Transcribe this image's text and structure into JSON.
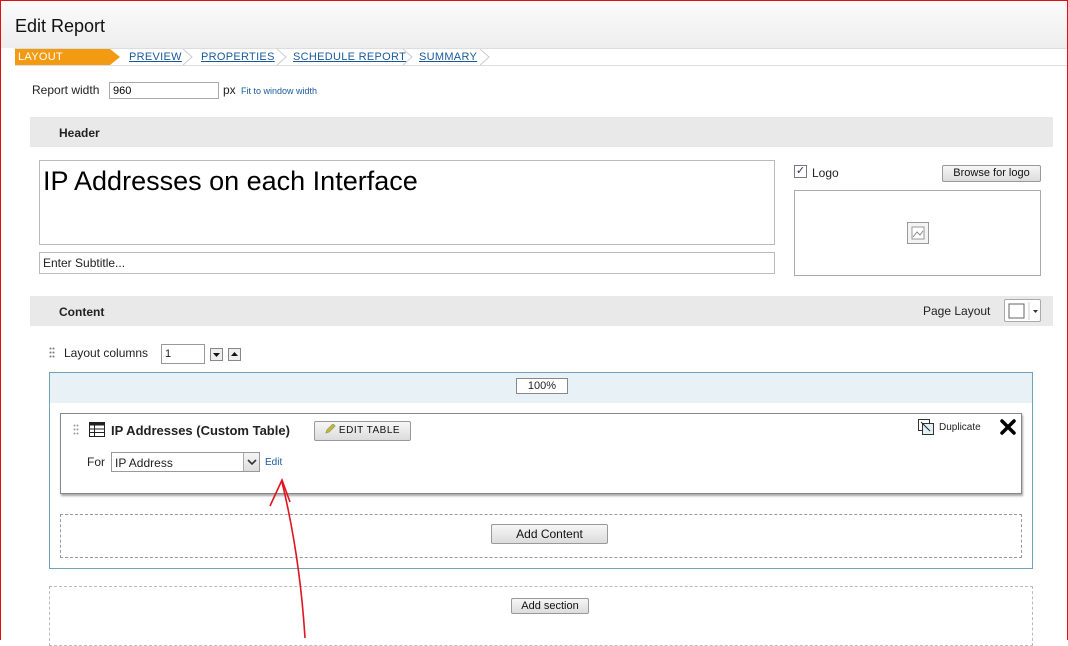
{
  "page": {
    "title": "Edit Report"
  },
  "steps": [
    {
      "label": "LAYOUT BUILDER",
      "active": true
    },
    {
      "label": "PREVIEW",
      "active": false
    },
    {
      "label": "PROPERTIES",
      "active": false
    },
    {
      "label": "SCHEDULE REPORT",
      "active": false
    },
    {
      "label": "SUMMARY",
      "active": false
    }
  ],
  "report_width": {
    "label": "Report width",
    "value": "960",
    "unit": "px",
    "fit_link": "Fit to window width"
  },
  "header": {
    "title": "Header",
    "report_title": "IP Addresses on each Interface",
    "subtitle": "Enter Subtitle...",
    "logo_label": "Logo",
    "logo_checked": true,
    "browse_button": "Browse for logo"
  },
  "content": {
    "title": "Content",
    "page_layout_label": "Page Layout",
    "layout_columns_label": "Layout columns",
    "layout_columns_value": "1",
    "column_width": "100%",
    "widget": {
      "title": "IP Addresses (Custom Table)",
      "edit_table_button": "EDIT TABLE",
      "duplicate_label": "Duplicate",
      "for_label": "For",
      "for_value": "IP Address",
      "edit_link": "Edit"
    },
    "add_content_button": "Add Content",
    "add_section_button": "Add section"
  },
  "colors": {
    "active_step": "#f29a12",
    "link": "#1a5a9c",
    "annotation": "#e0151f"
  }
}
